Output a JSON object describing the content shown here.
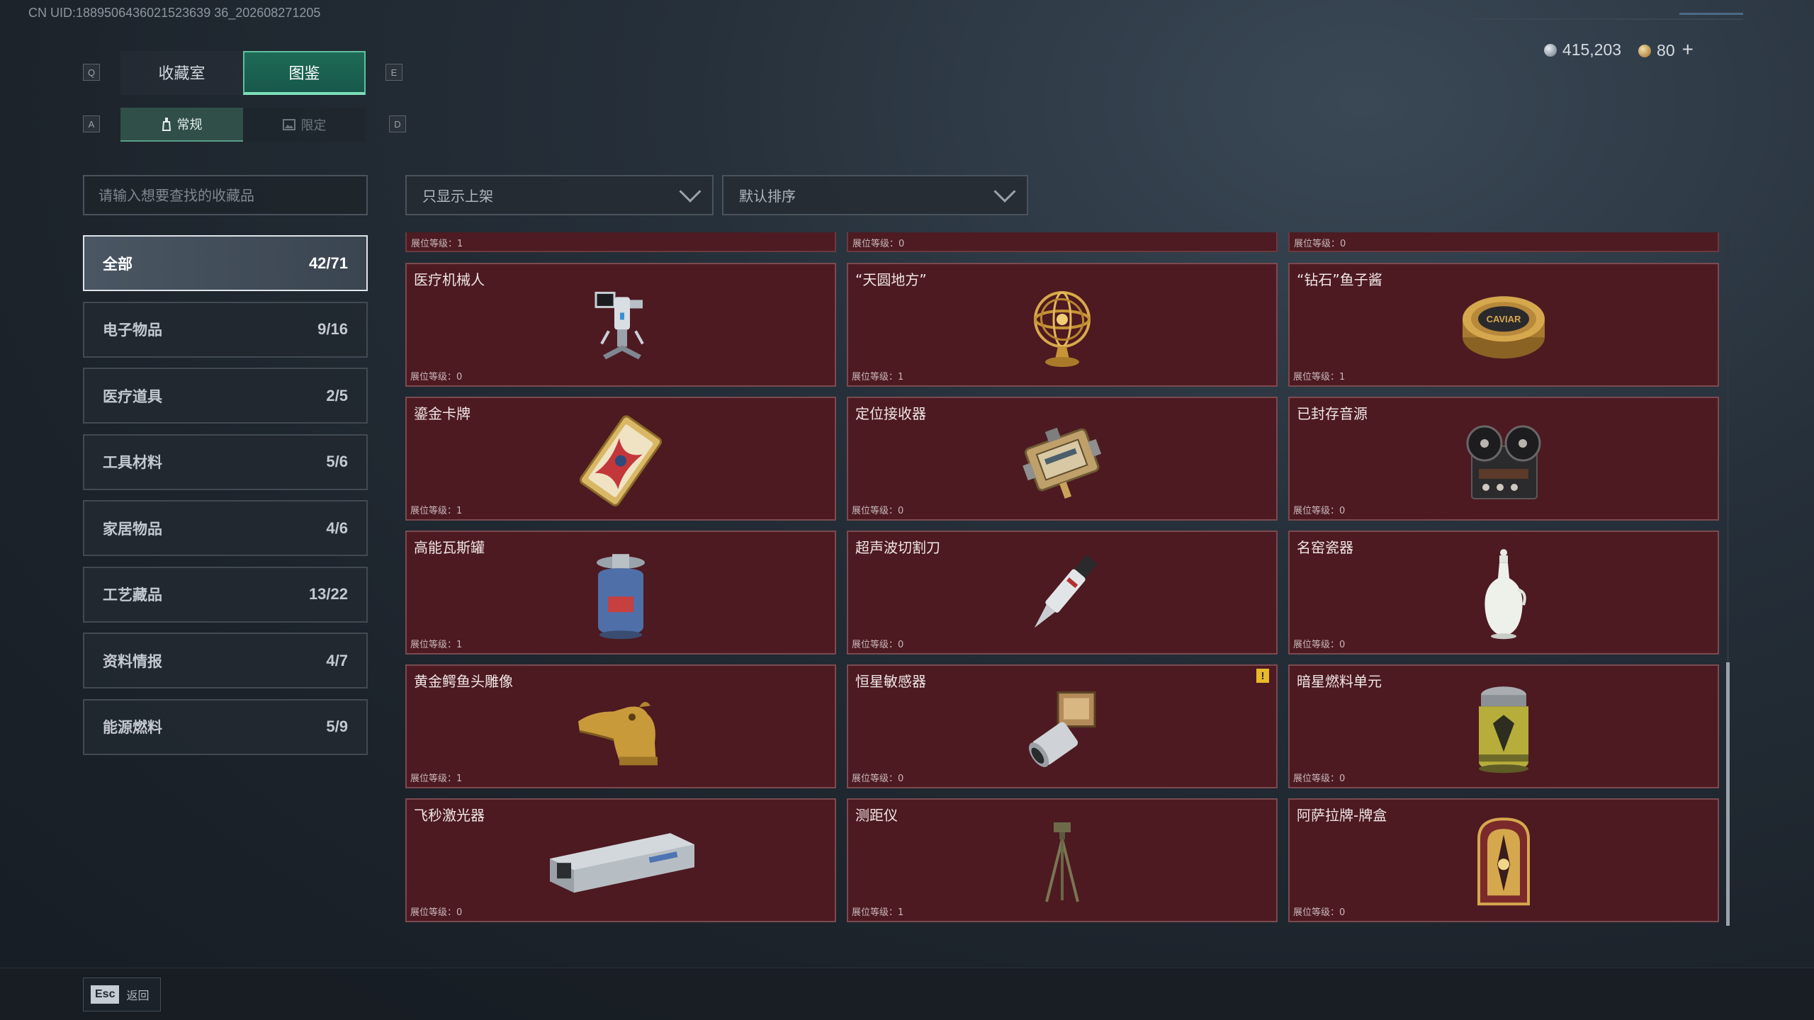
{
  "uid_text": "CN UID:1889506436021523639 36_202608271205",
  "currency": {
    "silver": "415,203",
    "gold": "80",
    "plus": "+"
  },
  "keys": {
    "q": "Q",
    "e": "E",
    "a": "A",
    "d": "D"
  },
  "main_tabs": [
    {
      "label": "收藏室",
      "active": false
    },
    {
      "label": "图鉴",
      "active": true
    }
  ],
  "sub_tabs": [
    {
      "label": "常规",
      "active": true
    },
    {
      "label": "限定",
      "active": false
    }
  ],
  "search": {
    "placeholder": "请输入想要查找的收藏品"
  },
  "filters": {
    "shelf": "只显示上架",
    "sort": "默认排序"
  },
  "categories": [
    {
      "label": "全部",
      "count": "42/71",
      "active": true
    },
    {
      "label": "电子物品",
      "count": "9/16"
    },
    {
      "label": "医疗道具",
      "count": "2/5"
    },
    {
      "label": "工具材料",
      "count": "5/6"
    },
    {
      "label": "家居物品",
      "count": "4/6"
    },
    {
      "label": "工艺藏品",
      "count": "13/22"
    },
    {
      "label": "资料情报",
      "count": "4/7"
    },
    {
      "label": "能源燃料",
      "count": "5/9"
    }
  ],
  "partial_row": [
    "展位等级：1",
    "展位等级：0",
    "展位等级：0"
  ],
  "items": [
    {
      "name": "医疗机械人",
      "level": "展位等级：0",
      "icon": "medical-robot-icon"
    },
    {
      "name": "“天圆地方”",
      "level": "展位等级：1",
      "icon": "armillary-sphere-icon"
    },
    {
      "name": "“钻石”鱼子酱",
      "level": "展位等级：1",
      "icon": "caviar-tin-icon",
      "tin_text": "CAVIAR"
    },
    {
      "name": "鎏金卡牌",
      "level": "展位等级：1",
      "icon": "gilded-card-icon"
    },
    {
      "name": "定位接收器",
      "level": "展位等级：0",
      "icon": "gps-receiver-icon"
    },
    {
      "name": "已封存音源",
      "level": "展位等级：0",
      "icon": "reel-recorder-icon"
    },
    {
      "name": "高能瓦斯罐",
      "level": "展位等级：1",
      "icon": "gas-canister-icon"
    },
    {
      "name": "超声波切割刀",
      "level": "展位等级：0",
      "icon": "ultrasonic-knife-icon"
    },
    {
      "name": "名窑瓷器",
      "level": "展位等级：0",
      "icon": "porcelain-vase-icon"
    },
    {
      "name": "黄金鳄鱼头雕像",
      "level": "展位等级：1",
      "icon": "gold-crocodile-icon"
    },
    {
      "name": "恒星敏感器",
      "level": "展位等级：0",
      "icon": "star-sensor-icon",
      "warning": "!"
    },
    {
      "name": "暗星燃料单元",
      "level": "展位等级：0",
      "icon": "fuel-cell-icon"
    },
    {
      "name": "飞秒激光器",
      "level": "展位等级：0",
      "icon": "femtosecond-laser-icon"
    },
    {
      "name": "测距仪",
      "level": "展位等级：1",
      "icon": "rangefinder-icon"
    },
    {
      "name": "阿萨拉牌-牌盒",
      "level": "展位等级：0",
      "icon": "card-box-icon"
    }
  ],
  "footer": {
    "key": "Esc",
    "label": "返回"
  },
  "colors": {
    "card_bg": "#4d1a21",
    "accent_green": "#1e6b57",
    "warning": "#e8b92a"
  }
}
